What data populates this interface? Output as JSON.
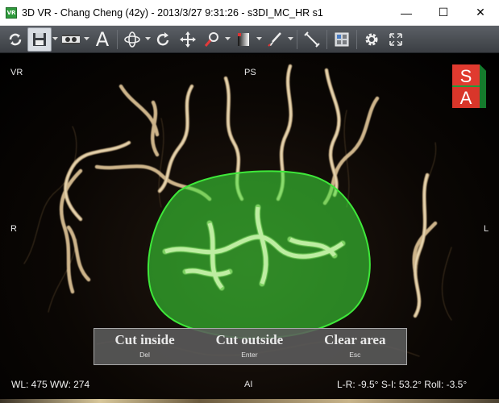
{
  "window": {
    "app_icon_text": "VR",
    "title": "3D VR - Chang Cheng (42y) - 2013/3/27 9:31:26 - s3DI_MC_HR s1",
    "minimize_glyph": "—",
    "maximize_glyph": "☐",
    "close_glyph": "✕"
  },
  "toolbar": {
    "tools": [
      "refresh-icon",
      "save-icon",
      "film-icon",
      "text-annotation-icon",
      "rotate-free-icon",
      "rotate-icon",
      "pan-icon",
      "zoom-icon",
      "window-level-icon",
      "brush-icon",
      "measure-line-icon",
      "layout-grid-icon",
      "settings-icon",
      "fullscreen-icon"
    ],
    "text_tool_label": "A"
  },
  "viewport": {
    "orientation": {
      "top_left": "VR",
      "top": "PS",
      "left": "R",
      "right": "L",
      "bottom": "AI"
    },
    "cube": {
      "top_label": "S",
      "front_label": "A",
      "top_color": "#e03a2f",
      "front_color": "#d9362a",
      "side_color": "#1d9d3a"
    },
    "cut_menu": [
      {
        "label": "Cut inside",
        "key": "Del"
      },
      {
        "label": "Cut outside",
        "key": "Enter"
      },
      {
        "label": "Clear area",
        "key": "Esc"
      }
    ],
    "status_left": "WL: 475 WW: 274",
    "status_right": "L-R: -9.5° S-I: 53.2° Roll: -3.5°",
    "selection_color": "#3ee83a"
  }
}
